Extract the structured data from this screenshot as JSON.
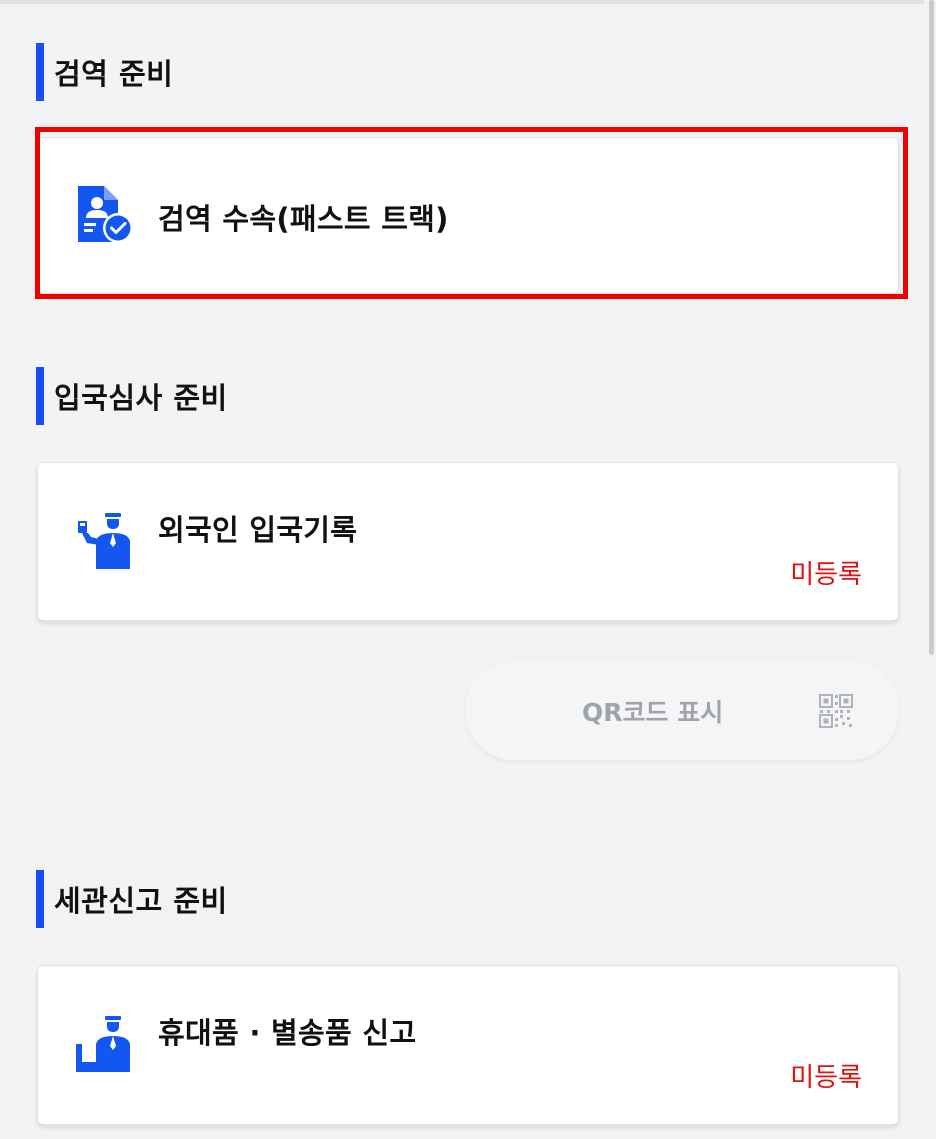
{
  "sections": [
    {
      "title": "검역 준비",
      "item": {
        "label": "검역 수속(패스트 트랙)",
        "icon": "quarantine-document-check-icon"
      }
    },
    {
      "title": "입국심사 준비",
      "item": {
        "label": "외국인 입국기록",
        "status": "미등록",
        "icon": "immigration-officer-icon"
      }
    },
    {
      "title": "세관신고 준비",
      "item": {
        "label": "휴대품 · 별송품 신고",
        "status": "미등록",
        "icon": "customs-officer-desk-icon"
      }
    }
  ],
  "qr_button": {
    "label": "QR코드 표시",
    "icon": "qr-code-icon"
  },
  "colors": {
    "accent": "#1a4cf5",
    "icon": "#1457f0",
    "status_red": "#e30f0f",
    "highlight": "#f20000",
    "background": "#f2f3f5"
  }
}
